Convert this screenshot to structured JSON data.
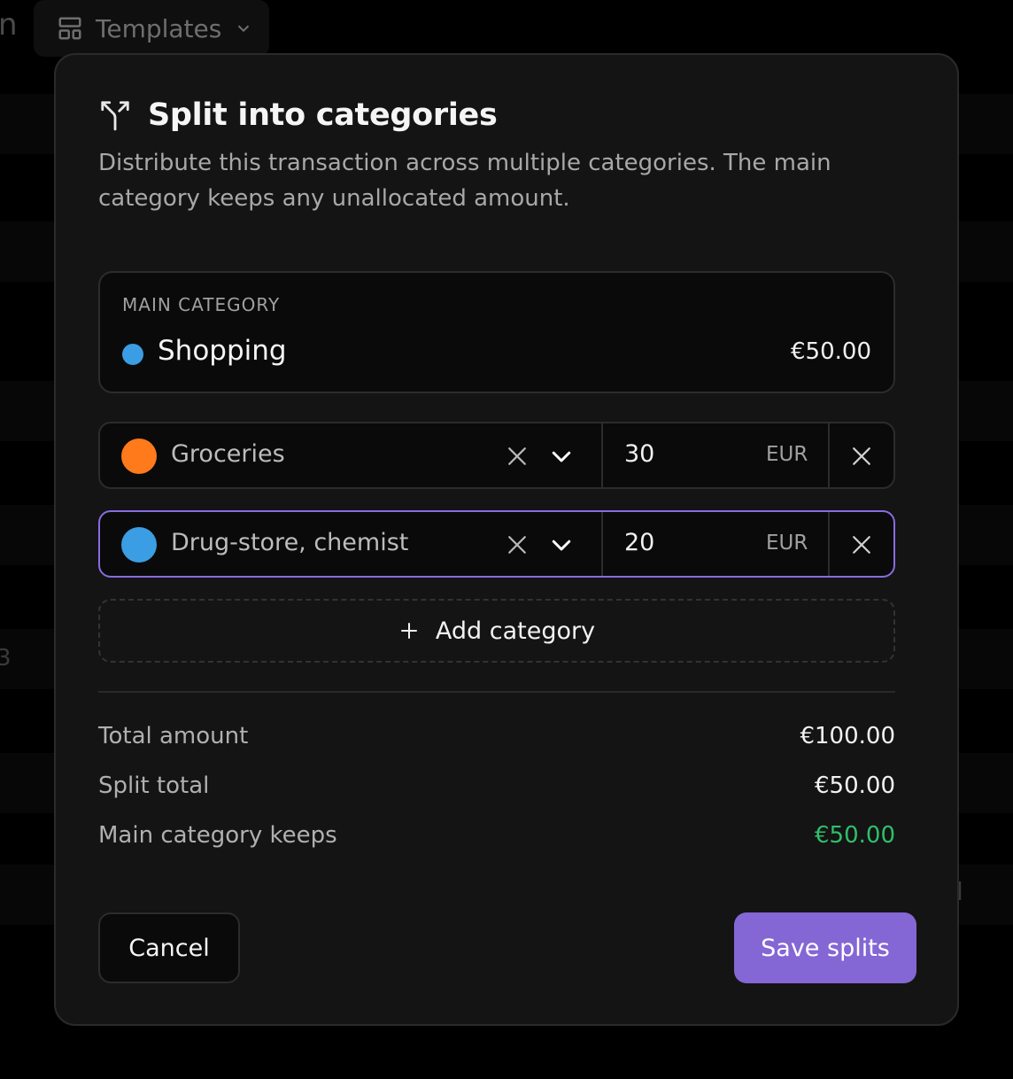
{
  "background": {
    "fragment_top": "n",
    "templates_button": {
      "label": "Templates",
      "icon": "layout-template-icon"
    },
    "fragment_left": "3",
    "fragment_right": "d"
  },
  "modal": {
    "title": "Split into categories",
    "title_icon": "split-icon",
    "description": "Distribute this transaction across multiple categories. The main category keeps any unallocated amount.",
    "main_category": {
      "label": "MAIN CATEGORY",
      "name": "Shopping",
      "amount": "€50.00",
      "color": "#3b9de3"
    },
    "splits": [
      {
        "category": "Groceries",
        "color": "#ff7a1a",
        "amount": "30",
        "currency": "EUR"
      },
      {
        "category": "Drug-store, chemist",
        "color": "#3b9de3",
        "amount": "20",
        "currency": "EUR",
        "focused": true
      }
    ],
    "add_category_label": "Add category",
    "summary": {
      "total_label": "Total amount",
      "total_value": "€100.00",
      "split_label": "Split total",
      "split_value": "€50.00",
      "keeps_label": "Main category keeps",
      "keeps_value": "€50.00"
    },
    "cancel_label": "Cancel",
    "save_label": "Save splits"
  },
  "colors": {
    "accent": "#8466d4",
    "focus_border": "#8a6be0",
    "positive": "#2fbf6a"
  }
}
